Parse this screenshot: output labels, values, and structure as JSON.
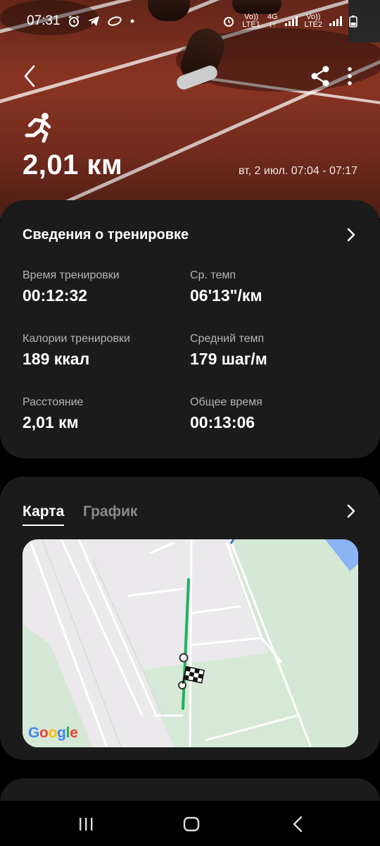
{
  "status_bar": {
    "time": "07:31",
    "sim1_label_top": "Vo))",
    "sim1_label_bottom": "LTE1",
    "network_top": "4G",
    "network_bottom": "↓↑",
    "sim2_label_top": "Vo))",
    "sim2_label_bottom": "LTE2"
  },
  "workout": {
    "distance": "2,01 км",
    "date_range": "вт, 2 июл. 07:04 - 07:17"
  },
  "details": {
    "title": "Сведения о тренировке",
    "metrics": [
      {
        "label": "Время тренировки",
        "value": "00:12:32"
      },
      {
        "label": "Ср. темп",
        "value": "06'13\"/км"
      },
      {
        "label": "Калории тренировки",
        "value": "189 ккал"
      },
      {
        "label": "Средний темп",
        "value": "179 шаг/м"
      },
      {
        "label": "Расстояние",
        "value": "2,01 км"
      },
      {
        "label": "Общее время",
        "value": "00:13:06"
      }
    ]
  },
  "map_card": {
    "tabs": [
      {
        "label": "Карта",
        "active": true
      },
      {
        "label": "График",
        "active": false
      }
    ],
    "map_logo": "Google",
    "route_color": "#1db35b"
  },
  "icons": {
    "back": "back-arrow-icon",
    "share": "share-icon",
    "more": "more-vertical-icon",
    "activity": "running-icon",
    "chevron": "chevron-right-icon",
    "finish": "checkered-flag-icon"
  }
}
